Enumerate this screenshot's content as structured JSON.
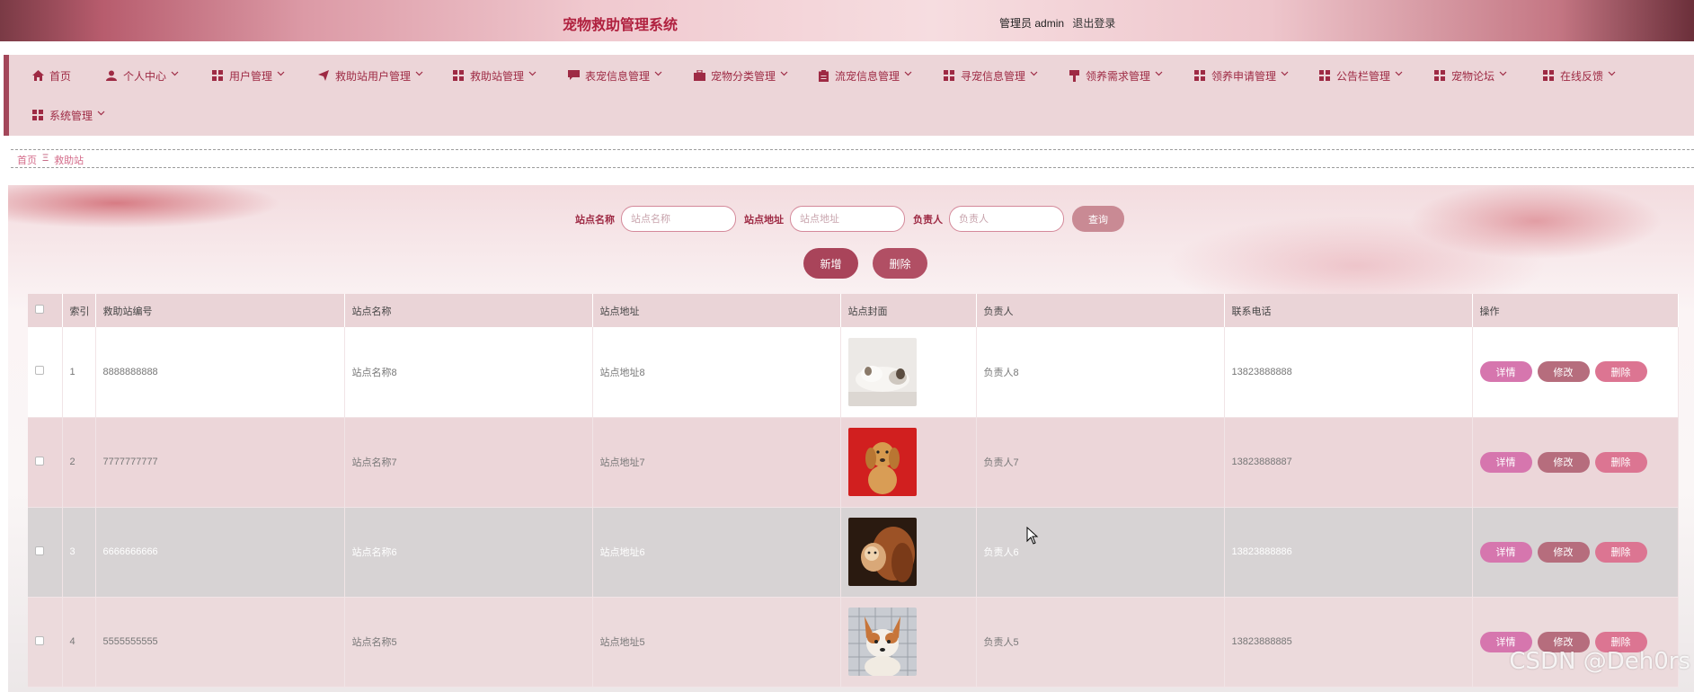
{
  "header": {
    "title": "宠物救助管理系统",
    "role": "管理员",
    "username": "admin",
    "logout": "退出登录"
  },
  "nav": {
    "items": [
      {
        "label": "首页",
        "icon": "home-icon"
      },
      {
        "label": "个人中心",
        "icon": "user-icon"
      },
      {
        "label": "用户管理",
        "icon": "grid-icon"
      },
      {
        "label": "救助站用户管理",
        "icon": "send-icon"
      },
      {
        "label": "救助站管理",
        "icon": "grid-icon"
      },
      {
        "label": "表宠信息管理",
        "icon": "chat-icon"
      },
      {
        "label": "宠物分类管理",
        "icon": "briefcase-icon"
      },
      {
        "label": "流宠信息管理",
        "icon": "clipboard-icon"
      },
      {
        "label": "寻宠信息管理",
        "icon": "grid-icon"
      },
      {
        "label": "领养需求管理",
        "icon": "pin-icon"
      },
      {
        "label": "领养申请管理",
        "icon": "grid-icon"
      },
      {
        "label": "公告栏管理",
        "icon": "grid-icon"
      },
      {
        "label": "宠物论坛",
        "icon": "grid-icon"
      },
      {
        "label": "在线反馈",
        "icon": "grid-icon"
      },
      {
        "label": "系统管理",
        "icon": "grid-icon"
      }
    ]
  },
  "breadcrumb": {
    "home": "首页",
    "separator": "Ξ",
    "current": "救助站"
  },
  "search": {
    "name_label": "站点名称",
    "name_placeholder": "站点名称",
    "address_label": "站点地址",
    "address_placeholder": "站点地址",
    "manager_label": "负责人",
    "manager_placeholder": "负责人",
    "query": "查询",
    "add": "新增",
    "delete": "删除"
  },
  "table": {
    "headers": [
      "",
      "索引",
      "救助站编号",
      "站点名称",
      "站点地址",
      "站点封面",
      "负责人",
      "联系电话",
      "操作"
    ],
    "actions": {
      "detail": "详情",
      "edit": "修改",
      "remove": "删除"
    },
    "rows": [
      {
        "index": "1",
        "code": "8888888888",
        "name": "站点名称8",
        "address": "站点地址8",
        "cover": "sleeping-dog-photo",
        "manager": "负责人8",
        "phone": "13823888888"
      },
      {
        "index": "2",
        "code": "7777777777",
        "name": "站点名称7",
        "address": "站点地址7",
        "cover": "golden-retriever-photo",
        "manager": "负责人7",
        "phone": "13823888887"
      },
      {
        "index": "3",
        "code": "6666666666",
        "name": "站点名称6",
        "address": "站点地址6",
        "cover": "dog-and-cat-photo",
        "manager": "负责人6",
        "phone": "13823888886"
      },
      {
        "index": "4",
        "code": "5555555555",
        "name": "站点名称5",
        "address": "站点地址5",
        "cover": "chihuahua-photo",
        "manager": "负责人5",
        "phone": "13823888885"
      }
    ]
  },
  "watermark": "CSDN @Deh0rs",
  "colors": {
    "accent": "#9e2a44",
    "nav_bg": "#ecd5d8",
    "detail_btn": "#d676ae",
    "edit_btn": "#b66d7d",
    "delete_btn": "#dc7592"
  }
}
